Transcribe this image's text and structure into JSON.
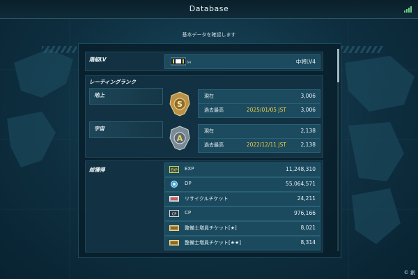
{
  "header": {
    "title": "Database",
    "subtitle": "基本データを確認します"
  },
  "rank_level": {
    "label": "階級LV",
    "rank_sub": "64",
    "value": "中将LV4"
  },
  "rating": {
    "label": "レーティングランク",
    "ground": {
      "label": "地上",
      "badge_letter": "S",
      "current_label": "現在",
      "current_value": "3,006",
      "best_label": "過去最高",
      "best_date": "2025/01/05 JST",
      "best_value": "3,006"
    },
    "space": {
      "label": "宇宙",
      "badge_letter": "A",
      "current_label": "現在",
      "current_value": "2,138",
      "best_label": "過去最高",
      "best_date": "2022/12/11 JST",
      "best_value": "2,138"
    }
  },
  "totals": {
    "label": "総獲得",
    "items": [
      {
        "icon": "exp-icon",
        "icon_text": "EXP",
        "label": "EXP",
        "value": "11,248,310"
      },
      {
        "icon": "dp-coin-icon",
        "icon_text": "",
        "label": "DP",
        "value": "55,064,571"
      },
      {
        "icon": "recycle-ticket-icon",
        "icon_text": "",
        "label": "リサイクルチケット",
        "value": "24,211"
      },
      {
        "icon": "cp-icon",
        "icon_text": "CP",
        "label": "CP",
        "value": "976,166"
      },
      {
        "icon": "mechanic-ticket-icon",
        "icon_text": "",
        "label": "整備士増員チケット[★]",
        "value": "8,021"
      },
      {
        "icon": "mechanic-ticket-2-icon",
        "icon_text": "",
        "label": "整備士増員チケット[★★]",
        "value": "8,314"
      }
    ]
  },
  "footer": {
    "copyright": "© 創"
  },
  "colors": {
    "accent": "#f2d34a",
    "panel": "#123243",
    "row": "#1c4a5e"
  }
}
